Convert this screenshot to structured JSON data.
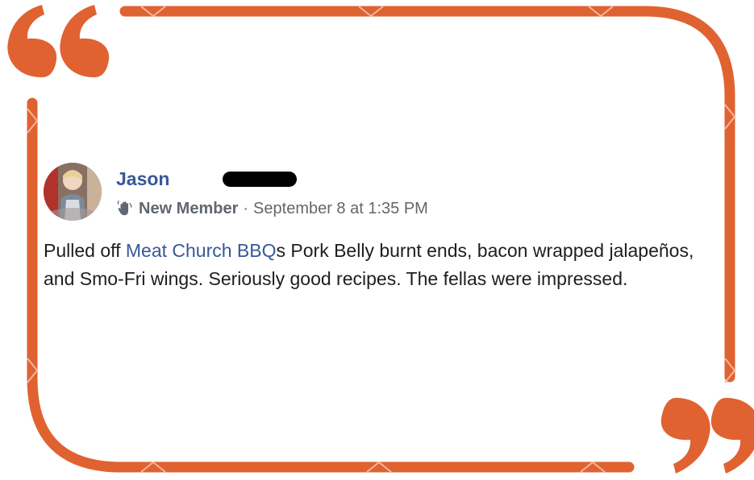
{
  "colors": {
    "frame": "#e06231",
    "link": "#385898",
    "text": "#1c1e21",
    "meta": "#65676b"
  },
  "post": {
    "author": {
      "name": "Jason",
      "name_redacted": true
    },
    "badge": {
      "icon": "wave-icon",
      "label": "New Member"
    },
    "separator": "·",
    "timestamp": "September 8 at 1:35 PM",
    "body": {
      "before_mention": "Pulled off ",
      "mention": "Meat Church BBQ",
      "after_mention": "s Pork Belly burnt ends, bacon wrapped jalapeños, and Smo-Fri wings. Seriously good recipes. The fellas were impressed."
    }
  }
}
